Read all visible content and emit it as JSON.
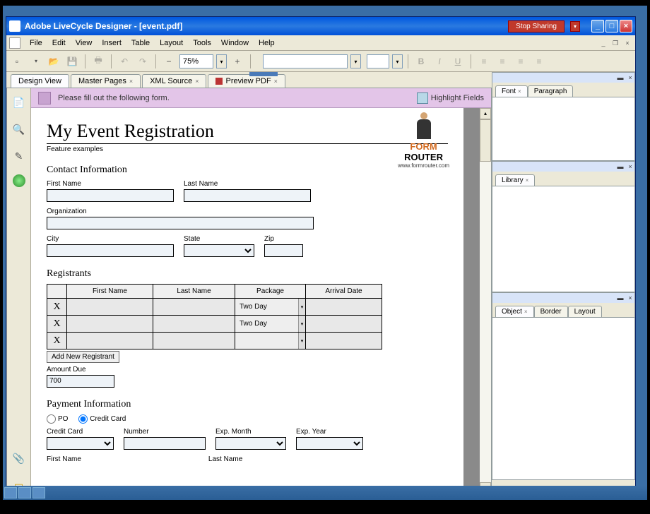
{
  "window": {
    "title": "Adobe LiveCycle Designer - [event.pdf]",
    "stop_sharing": "Stop Sharing"
  },
  "menu": {
    "file": "File",
    "edit": "Edit",
    "view": "View",
    "insert": "Insert",
    "table": "Table",
    "layout": "Layout",
    "tools": "Tools",
    "window": "Window",
    "help": "Help"
  },
  "toolbar": {
    "zoom": "75%"
  },
  "tabs": {
    "design_view": "Design View",
    "master_pages": "Master Pages",
    "xml_source": "XML Source",
    "preview_pdf": "Preview PDF"
  },
  "infobar": {
    "message": "Please fill out the following form.",
    "highlight": "Highlight Fields"
  },
  "form": {
    "title": "My Event Registration",
    "subtitle": "Feature examples",
    "logo_brand1": "FORM",
    "logo_brand2": "ROUTER",
    "logo_url": "www.formrouter.com",
    "contact_hdr": "Contact Information",
    "first_name_lbl": "First Name",
    "last_name_lbl": "Last Name",
    "organization_lbl": "Organization",
    "city_lbl": "City",
    "state_lbl": "State",
    "zip_lbl": "Zip",
    "registrants_hdr": "Registrants",
    "col_first": "First Name",
    "col_last": "Last Name",
    "col_package": "Package",
    "col_arrival": "Arrival Date",
    "row_x": "X",
    "package_val": "Two Day",
    "add_registrant": "Add New Registrant",
    "amount_due_lbl": "Amount Due",
    "amount_due_val": "700",
    "payment_hdr": "Payment Information",
    "po_lbl": "PO",
    "cc_lbl": "Credit Card",
    "credit_card_lbl": "Credit Card",
    "number_lbl": "Number",
    "exp_month_lbl": "Exp. Month",
    "exp_year_lbl": "Exp. Year",
    "first_name_lbl2": "First Name",
    "last_name_lbl2": "Last Name"
  },
  "panels": {
    "font": "Font",
    "paragraph": "Paragraph",
    "library": "Library",
    "object": "Object",
    "border": "Border",
    "layout": "Layout"
  }
}
